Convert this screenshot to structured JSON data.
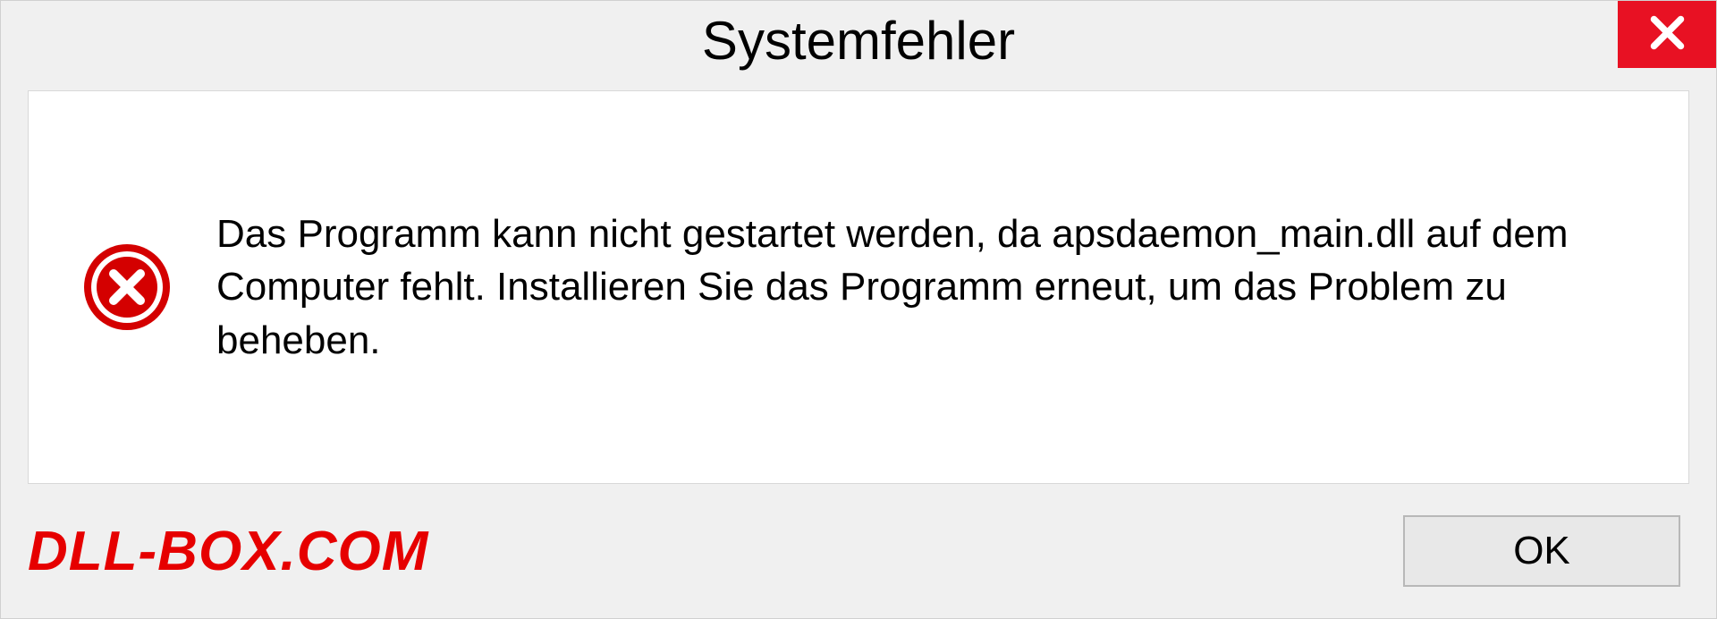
{
  "dialog": {
    "title": "Systemfehler",
    "message": "Das Programm kann nicht gestartet werden, da apsdaemon_main.dll auf dem Computer fehlt. Installieren Sie das Programm erneut, um das Problem zu beheben.",
    "ok_label": "OK"
  },
  "watermark": "DLL-BOX.COM",
  "colors": {
    "close_bg": "#e81123",
    "error_icon": "#d40000",
    "watermark": "#e60000"
  }
}
